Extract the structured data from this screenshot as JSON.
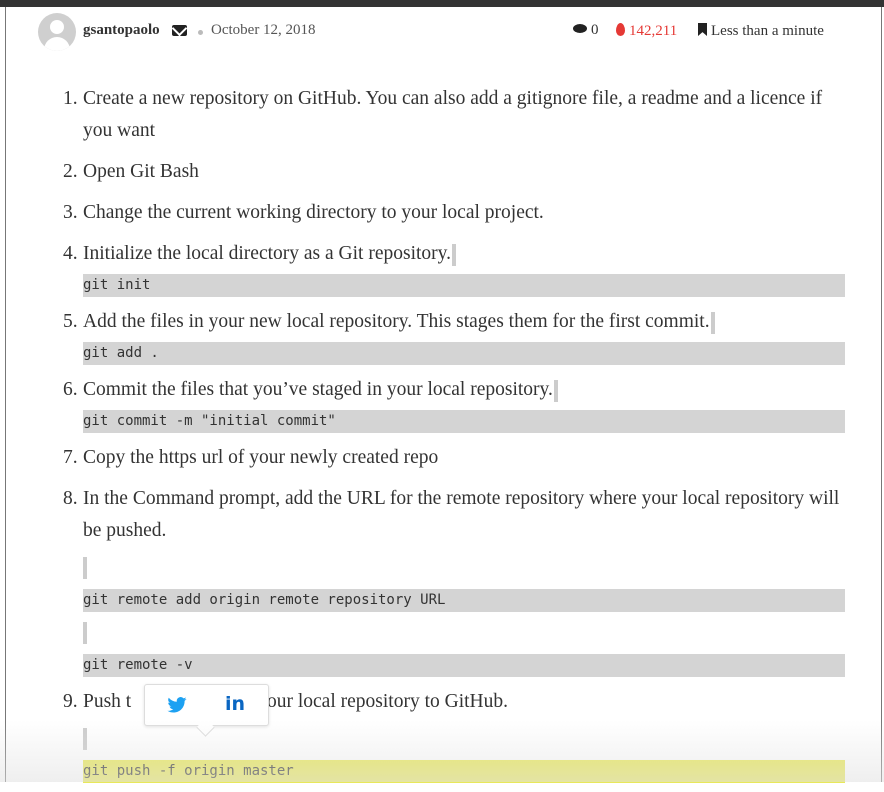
{
  "meta": {
    "author": "gsantopaolo",
    "date": "October 12, 2018",
    "comments": "0",
    "views": "142,211",
    "read_time": "Less than a minute"
  },
  "steps": [
    {
      "num": "1.",
      "text": "Create a new repository on GitHub. You can also add a gitignore file, a readme and a licence if you want"
    },
    {
      "num": "2.",
      "text": " Open Git Bash"
    },
    {
      "num": "3.",
      "text": "Change the current working directory to your local project."
    },
    {
      "num": "4.",
      "text": "Initialize the local directory as a Git repository.",
      "code": "git init"
    },
    {
      "num": "5.",
      "text": "Add the files in your new local repository. This stages them for the first commit.",
      "code": "git add ."
    },
    {
      "num": "6.",
      "text": " Commit the files that you’ve staged in your local repository.",
      "code": "git commit -m \"initial commit\""
    },
    {
      "num": "7.",
      "text": " Copy the https url of your newly created repo"
    },
    {
      "num": "8.",
      "text": "In the Command prompt, add the URL for the remote repository where your local repository will be pushed.",
      "code1": "git remote add origin remote repository URL",
      "code2": "git remote -v"
    },
    {
      "num": "9.",
      "text_start": " Push t",
      "text_end": "your local repository to GitHub.",
      "code": "git push -f origin master"
    }
  ],
  "share": {
    "icons": [
      "twitter-icon",
      "linkedin-icon"
    ],
    "twitter_glyph": "🐦",
    "linkedin_glyph": "in"
  },
  "colors": {
    "views": "#e53935",
    "highlight": "#e8e85a",
    "code_bg": "#d4d4d4",
    "twitter": "#1da1f2",
    "linkedin": "#0a66c2"
  }
}
